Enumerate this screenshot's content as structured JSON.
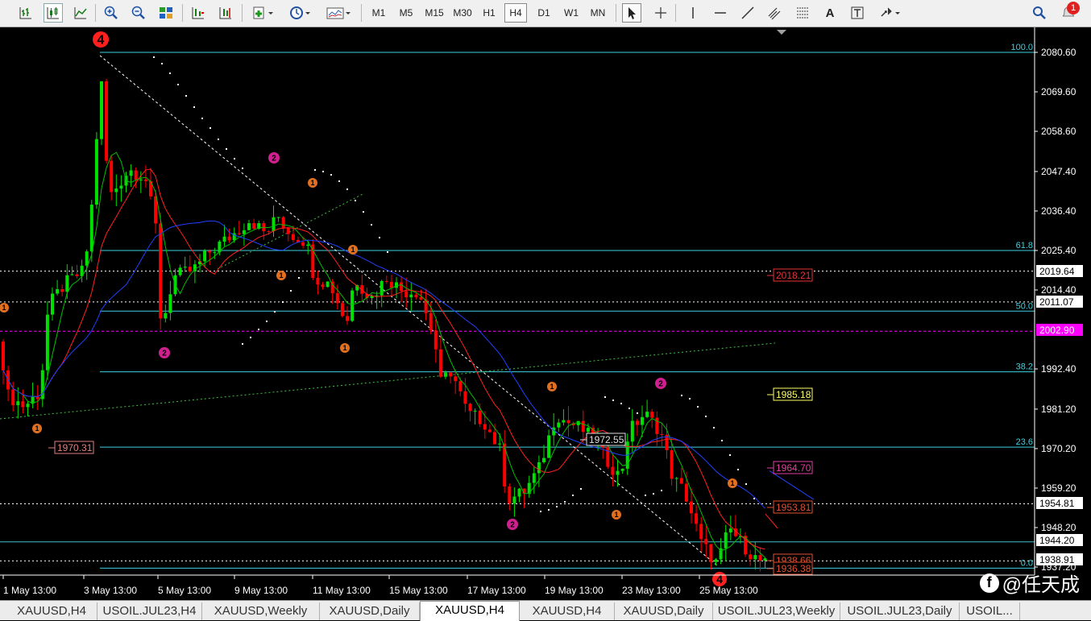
{
  "toolbar": {
    "timeframes": [
      "M1",
      "M5",
      "M15",
      "M30",
      "H1",
      "H4",
      "D1",
      "W1",
      "MN"
    ],
    "active_timeframe": "H4",
    "notification_count": "1"
  },
  "chart": {
    "symbol": "XAUUSD",
    "period": "H4",
    "price_axis": [
      "2080.60",
      "2069.60",
      "2058.60",
      "2047.40",
      "2036.40",
      "2025.40",
      "2014.40",
      "1992.40",
      "1981.20",
      "1970.20",
      "1959.20",
      "1948.20",
      "1937.20"
    ],
    "date_axis": [
      "1 May 13:00",
      "3 May 13:00",
      "5 May 13:00",
      "9 May 13:00",
      "11 May 13:00",
      "15 May 13:00",
      "17 May 13:00",
      "19 May 13:00",
      "23 May 13:00",
      "25 May 13:00"
    ],
    "axis_tags": [
      {
        "label": "2019.64",
        "style": "white"
      },
      {
        "label": "2011.07",
        "style": "white"
      },
      {
        "label": "2002.90",
        "style": "magenta"
      },
      {
        "label": "1954.81",
        "style": "white"
      },
      {
        "label": "1944.20",
        "style": "white"
      },
      {
        "label": "1938.91",
        "style": "white"
      }
    ],
    "fib_levels": [
      {
        "label": "100.0",
        "price": 2080.6
      },
      {
        "label": "61.8",
        "price": 2025.4
      },
      {
        "label": "50.0",
        "price": 2008.5
      },
      {
        "label": "38.2",
        "price": 1991.6
      },
      {
        "label": "23.6",
        "price": 1970.6
      },
      {
        "label": "0.0",
        "price": 1936.9
      }
    ],
    "price_labels": [
      {
        "label": "2018.21",
        "color": "#e8303a"
      },
      {
        "label": "1985.18",
        "color": "#ffff66"
      },
      {
        "label": "1964.70",
        "color": "#e040a0"
      },
      {
        "label": "1953.81",
        "color": "#e05030"
      },
      {
        "label": "1938.66",
        "color": "#e05030"
      },
      {
        "label": "1936.38",
        "color": "#e05030"
      },
      {
        "label": "1970.31",
        "color": "#e08080"
      },
      {
        "label": "1972.55",
        "color": "#e0e0e0"
      }
    ],
    "wave_markers": {
      "big_4": "4",
      "orange_1": "1",
      "magenta_2": "2"
    },
    "colors": {
      "bull": "#00e000",
      "bear": "#ff0000",
      "ma_fast": "#00c000",
      "ma_mid": "#ff2020",
      "ma_slow": "#2040ff",
      "fib": "#40d0e0",
      "magenta": "#ff00ff"
    }
  },
  "tabs": [
    {
      "label": "XAUUSD,H4"
    },
    {
      "label": "USOIL.JUL23,H4"
    },
    {
      "label": "XAUUSD,Weekly"
    },
    {
      "label": "XAUUSD,Daily"
    },
    {
      "label": "XAUUSD,H4",
      "active": true
    },
    {
      "label": "XAUUSD,H4"
    },
    {
      "label": "XAUUSD,Daily"
    },
    {
      "label": "USOIL.JUL23,Weekly"
    },
    {
      "label": "USOIL.JUL23,Daily"
    },
    {
      "label": "USOIL..."
    }
  ],
  "watermark": {
    "text": "@任天成",
    "logo": "facebook-icon"
  }
}
